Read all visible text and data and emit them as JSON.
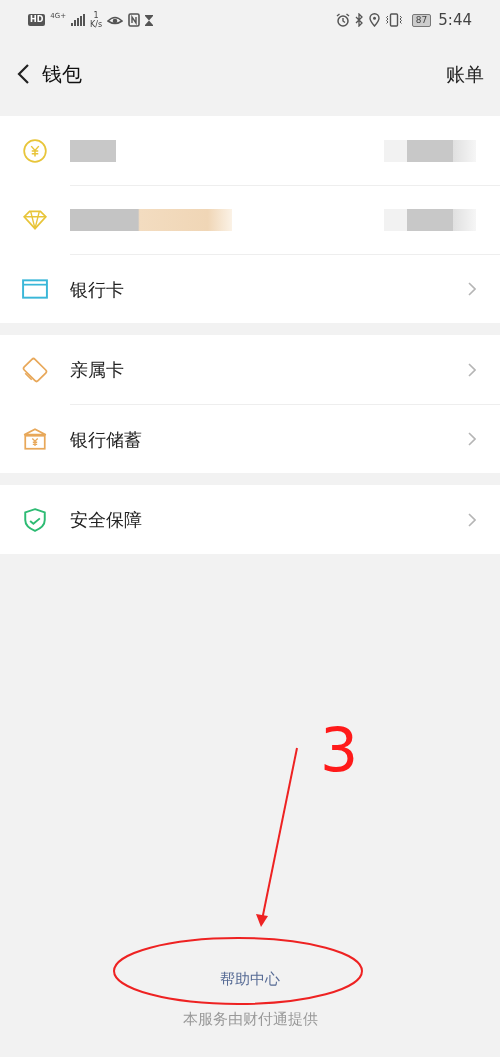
{
  "status_bar": {
    "hd": "HD",
    "network": "4G+",
    "speed_value": "1",
    "speed_unit": "K/s",
    "battery": "87",
    "time": "5:44"
  },
  "header": {
    "title": "钱包",
    "action": "账单"
  },
  "sections": [
    {
      "items": [
        {
          "kind": "redacted"
        },
        {
          "kind": "redacted"
        },
        {
          "kind": "link",
          "label": "银行卡"
        }
      ]
    },
    {
      "items": [
        {
          "kind": "link",
          "label": "亲属卡"
        },
        {
          "kind": "link",
          "label": "银行储蓄"
        }
      ]
    },
    {
      "items": [
        {
          "kind": "link",
          "label": "安全保障"
        }
      ]
    }
  ],
  "annotation": {
    "step": "3"
  },
  "footer": {
    "help_link": "帮助中心",
    "provider": "本服务由财付通提供"
  }
}
